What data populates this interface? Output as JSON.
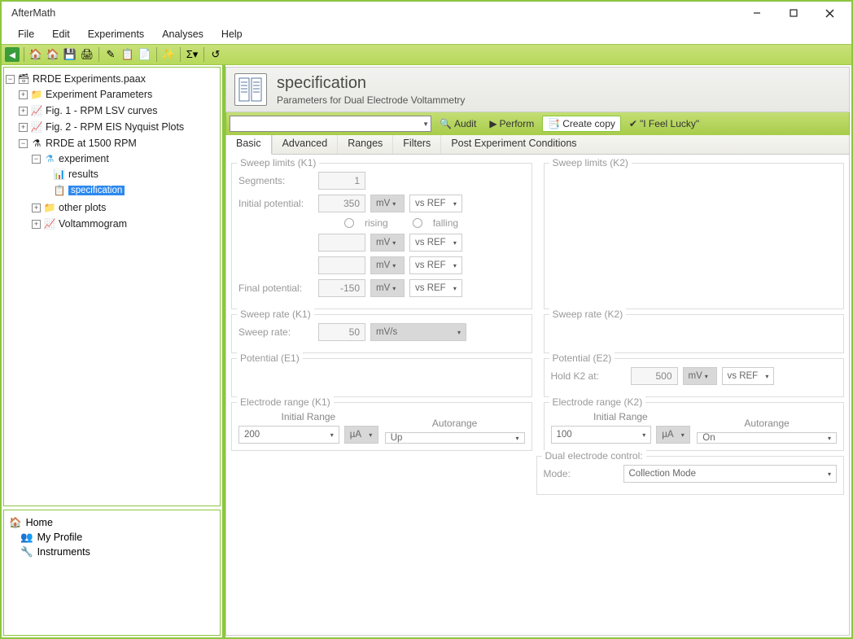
{
  "window": {
    "title": "AfterMath"
  },
  "menu": {
    "file": "File",
    "edit": "Edit",
    "experiments": "Experiments",
    "analyses": "Analyses",
    "help": "Help"
  },
  "tree": {
    "root": "RRDE Experiments.paax",
    "n1": "Experiment Parameters",
    "n2": "Fig. 1 - RPM LSV curves",
    "n3": "Fig. 2 - RPM EIS Nyquist Plots",
    "n4": "RRDE at 1500 RPM",
    "n4a": "experiment",
    "n4a1": "results",
    "n4a2": "specification",
    "n4b": "other plots",
    "n4c": "Voltammogram"
  },
  "nav": {
    "home": "Home",
    "profile": "My Profile",
    "instruments": "Instruments"
  },
  "header": {
    "title": "specification",
    "sub": "Parameters for Dual Electrode Voltammetry"
  },
  "actions": {
    "audit": "Audit",
    "perform": "Perform",
    "copy": "Create copy",
    "lucky": "\"I Feel Lucky\""
  },
  "tabs": {
    "basic": "Basic",
    "advanced": "Advanced",
    "ranges": "Ranges",
    "filters": "Filters",
    "post": "Post Experiment Conditions"
  },
  "groups": {
    "sweepK1": "Sweep limits (K1)",
    "sweepK2": "Sweep limits (K2)",
    "rateK1": "Sweep rate (K1)",
    "rateK2": "Sweep rate (K2)",
    "potE1": "Potential (E1)",
    "potE2": "Potential (E2)",
    "elecK1": "Electrode range (K1)",
    "elecK2": "Electrode range (K2)",
    "dual": "Dual electrode control:"
  },
  "labels": {
    "segments": "Segments:",
    "initial": "Initial potential:",
    "final": "Final potential:",
    "rising": "rising",
    "falling": "falling",
    "rate": "Sweep rate:",
    "holdK2": "Hold K2 at:",
    "initrange": "Initial Range",
    "autorange": "Autorange",
    "mode": "Mode:"
  },
  "vals": {
    "segments": "1",
    "initial": "350",
    "final": "-150",
    "rate": "50",
    "holdK2": "500",
    "mv": "mV",
    "mvs": "mV/s",
    "vsref": "vs REF",
    "uA": "µA",
    "rangeK1": "200",
    "autoK1": "Up",
    "rangeK2": "100",
    "autoK2": "On",
    "mode": "Collection Mode"
  }
}
